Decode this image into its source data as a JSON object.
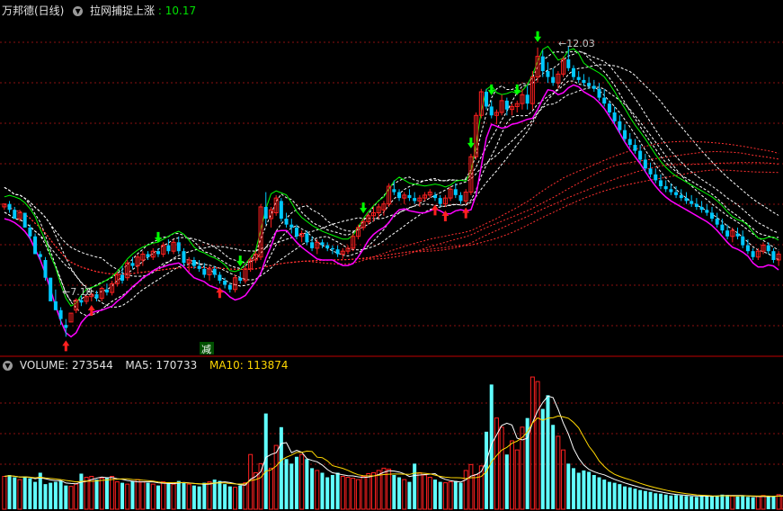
{
  "header": {
    "stock_name": "万邦德(日线)",
    "indicator_name": "拉网捕捉上涨",
    "indicator_value": "10.17"
  },
  "volume_header": {
    "label": "VOLUME:",
    "value": "273544",
    "ma5_label": "MA5:",
    "ma5_value": "170733",
    "ma10_label": "MA10:",
    "ma10_value": "113874"
  },
  "annotations": {
    "high": "12.03",
    "low": "7.10",
    "reduce": "减"
  },
  "colors": {
    "background": "#000000",
    "up": "#ff2020",
    "down": "#00c8ff",
    "doji": "#ffffff",
    "grid": "#8b1010",
    "divider": "#c00000",
    "ma_dashed": "#ffffff",
    "ma_slow": "#ff3030",
    "band_upper": "#00ff00",
    "band_lower_fast": "#ff00ff",
    "volume_up": "#ff2020",
    "volume_down": "#60ffff",
    "vol_ma5": "#ffffff",
    "vol_ma10": "#ffd700",
    "buy_arrow": "#ff2020",
    "sell_arrow": "#00ff00"
  },
  "chart_data": [
    {
      "type": "candlestick",
      "title": "万邦德(日线)",
      "ylim": [
        6.8,
        12.5
      ],
      "candles": [
        [
          9.3,
          9.35,
          9.25,
          9.35
        ],
        [
          9.35,
          9.4,
          9.2,
          9.25
        ],
        [
          9.25,
          9.3,
          9.1,
          9.1
        ],
        [
          9.1,
          9.25,
          9.05,
          9.2
        ],
        [
          9.2,
          9.2,
          8.95,
          8.95
        ],
        [
          8.95,
          9.0,
          8.75,
          8.8
        ],
        [
          8.8,
          8.85,
          8.5,
          8.5
        ],
        [
          8.5,
          8.55,
          8.4,
          8.45
        ],
        [
          8.4,
          8.45,
          8.05,
          8.1
        ],
        [
          8.1,
          8.1,
          7.7,
          7.7
        ],
        [
          7.7,
          7.9,
          7.55,
          7.55
        ],
        [
          7.55,
          7.6,
          7.3,
          7.4
        ],
        [
          7.3,
          7.4,
          7.1,
          7.25
        ],
        [
          7.35,
          7.5,
          7.35,
          7.5
        ],
        [
          7.55,
          7.75,
          7.5,
          7.72
        ],
        [
          7.72,
          7.8,
          7.62,
          7.68
        ],
        [
          7.7,
          7.8,
          7.65,
          7.78
        ],
        [
          7.78,
          7.85,
          7.7,
          7.82
        ],
        [
          7.82,
          7.88,
          7.7,
          7.75
        ],
        [
          7.75,
          7.95,
          7.7,
          7.92
        ],
        [
          7.9,
          8.0,
          7.8,
          7.85
        ],
        [
          7.85,
          8.05,
          7.8,
          8.0
        ],
        [
          8.0,
          8.2,
          7.95,
          8.15
        ],
        [
          8.15,
          8.3,
          8.0,
          8.05
        ],
        [
          8.1,
          8.4,
          8.05,
          8.35
        ],
        [
          8.35,
          8.45,
          8.25,
          8.3
        ],
        [
          8.3,
          8.5,
          8.2,
          8.45
        ],
        [
          8.4,
          8.55,
          8.3,
          8.5
        ],
        [
          8.5,
          8.55,
          8.4,
          8.45
        ],
        [
          8.45,
          8.6,
          8.4,
          8.55
        ],
        [
          8.55,
          8.6,
          8.45,
          8.5
        ],
        [
          8.5,
          8.7,
          8.45,
          8.65
        ],
        [
          8.65,
          8.75,
          8.5,
          8.55
        ],
        [
          8.55,
          8.75,
          8.5,
          8.7
        ],
        [
          8.7,
          8.8,
          8.5,
          8.55
        ],
        [
          8.55,
          8.6,
          8.3,
          8.35
        ],
        [
          8.35,
          8.45,
          8.2,
          8.4
        ],
        [
          8.4,
          8.45,
          8.25,
          8.3
        ],
        [
          8.3,
          8.4,
          8.2,
          8.25
        ],
        [
          8.25,
          8.35,
          8.1,
          8.15
        ],
        [
          8.15,
          8.3,
          8.05,
          8.25
        ],
        [
          8.25,
          8.3,
          8.1,
          8.15
        ],
        [
          8.15,
          8.2,
          8.0,
          8.05
        ],
        [
          8.05,
          8.1,
          7.92,
          7.98
        ],
        [
          7.98,
          8.0,
          7.85,
          7.9
        ],
        [
          7.9,
          8.15,
          7.85,
          8.1
        ],
        [
          8.1,
          8.2,
          8.0,
          8.05
        ],
        [
          8.05,
          8.3,
          8.0,
          8.25
        ],
        [
          8.25,
          8.45,
          8.2,
          8.4
        ],
        [
          8.4,
          8.55,
          8.35,
          8.5
        ],
        [
          8.45,
          9.35,
          8.4,
          9.3
        ],
        [
          9.3,
          9.55,
          9.0,
          9.1
        ],
        [
          9.1,
          9.3,
          8.95,
          9.25
        ],
        [
          9.2,
          9.5,
          9.15,
          9.45
        ],
        [
          9.4,
          9.45,
          9.05,
          9.1
        ],
        [
          9.1,
          9.2,
          8.95,
          9.0
        ],
        [
          9.0,
          9.1,
          8.85,
          8.95
        ],
        [
          8.95,
          9.0,
          8.75,
          8.8
        ],
        [
          8.8,
          8.9,
          8.7,
          8.85
        ],
        [
          8.85,
          8.9,
          8.65,
          8.7
        ],
        [
          8.7,
          8.8,
          8.55,
          8.6
        ],
        [
          8.6,
          8.75,
          8.5,
          8.7
        ],
        [
          8.7,
          8.75,
          8.6,
          8.65
        ],
        [
          8.65,
          8.7,
          8.55,
          8.6
        ],
        [
          8.6,
          8.65,
          8.5,
          8.58
        ],
        [
          8.58,
          8.65,
          8.45,
          8.5
        ],
        [
          8.5,
          8.6,
          8.42,
          8.55
        ],
        [
          8.55,
          8.65,
          8.5,
          8.6
        ],
        [
          8.6,
          8.85,
          8.55,
          8.8
        ],
        [
          8.8,
          9.0,
          8.75,
          8.95
        ],
        [
          8.95,
          9.1,
          8.9,
          9.05
        ],
        [
          9.05,
          9.2,
          9.0,
          9.15
        ],
        [
          9.15,
          9.3,
          9.05,
          9.2
        ],
        [
          9.2,
          9.35,
          9.1,
          9.3
        ],
        [
          9.25,
          9.4,
          9.15,
          9.35
        ],
        [
          9.35,
          9.7,
          9.3,
          9.65
        ],
        [
          9.6,
          9.75,
          9.5,
          9.55
        ],
        [
          9.55,
          9.6,
          9.4,
          9.45
        ],
        [
          9.45,
          9.55,
          9.35,
          9.5
        ],
        [
          9.5,
          9.6,
          9.4,
          9.45
        ],
        [
          9.45,
          9.55,
          9.35,
          9.4
        ],
        [
          9.4,
          9.5,
          9.3,
          9.45
        ],
        [
          9.45,
          9.55,
          9.4,
          9.5
        ],
        [
          9.5,
          9.6,
          9.45,
          9.55
        ],
        [
          9.5,
          9.55,
          9.4,
          9.45
        ],
        [
          9.45,
          9.5,
          9.3,
          9.35
        ],
        [
          9.35,
          9.5,
          9.3,
          9.45
        ],
        [
          9.45,
          9.65,
          9.4,
          9.6
        ],
        [
          9.6,
          9.7,
          9.45,
          9.5
        ],
        [
          9.5,
          9.55,
          9.35,
          9.4
        ],
        [
          9.4,
          9.6,
          9.35,
          9.55
        ],
        [
          9.55,
          10.2,
          9.5,
          10.15
        ],
        [
          10.15,
          10.9,
          10.1,
          10.85
        ],
        [
          10.85,
          11.3,
          10.8,
          11.25
        ],
        [
          11.25,
          11.3,
          10.95,
          11.0
        ],
        [
          11.0,
          11.1,
          10.8,
          10.85
        ],
        [
          10.85,
          10.95,
          10.7,
          10.9
        ],
        [
          10.9,
          11.2,
          10.85,
          11.1
        ],
        [
          11.1,
          11.15,
          10.85,
          10.95
        ],
        [
          10.95,
          11.05,
          10.85,
          11.0
        ],
        [
          11.0,
          11.1,
          10.9,
          11.05
        ],
        [
          11.05,
          11.3,
          10.95,
          11.2
        ],
        [
          11.2,
          11.35,
          10.95,
          11.05
        ],
        [
          11.05,
          11.6,
          10.95,
          11.5
        ],
        [
          11.5,
          12.0,
          11.4,
          11.85
        ],
        [
          11.85,
          11.95,
          11.5,
          11.6
        ],
        [
          11.6,
          11.75,
          11.4,
          11.5
        ],
        [
          11.5,
          11.65,
          11.35,
          11.4
        ],
        [
          11.4,
          11.6,
          11.3,
          11.55
        ],
        [
          11.55,
          11.85,
          11.5,
          11.8
        ],
        [
          11.8,
          12.03,
          11.6,
          11.65
        ],
        [
          11.65,
          11.7,
          11.45,
          11.5
        ],
        [
          11.5,
          11.6,
          11.4,
          11.45
        ],
        [
          11.45,
          11.55,
          11.35,
          11.4
        ],
        [
          11.4,
          11.5,
          11.3,
          11.35
        ],
        [
          11.35,
          11.45,
          11.25,
          11.3
        ],
        [
          11.3,
          11.4,
          11.1,
          11.15
        ],
        [
          11.15,
          11.3,
          11.0,
          11.05
        ],
        [
          11.05,
          11.1,
          10.85,
          10.9
        ],
        [
          10.9,
          11.0,
          10.7,
          10.75
        ],
        [
          10.75,
          10.85,
          10.55,
          10.6
        ],
        [
          10.6,
          10.7,
          10.4,
          10.45
        ],
        [
          10.45,
          10.55,
          10.3,
          10.35
        ],
        [
          10.35,
          10.45,
          10.2,
          10.25
        ],
        [
          10.25,
          10.35,
          10.05,
          10.1
        ],
        [
          10.1,
          10.2,
          9.9,
          9.95
        ],
        [
          9.95,
          10.05,
          9.8,
          9.85
        ],
        [
          9.85,
          9.95,
          9.7,
          9.75
        ],
        [
          9.75,
          9.85,
          9.6,
          9.65
        ],
        [
          9.65,
          9.75,
          9.55,
          9.6
        ],
        [
          9.6,
          9.7,
          9.5,
          9.55
        ],
        [
          9.55,
          9.65,
          9.45,
          9.5
        ],
        [
          9.5,
          9.6,
          9.4,
          9.45
        ],
        [
          9.45,
          9.55,
          9.35,
          9.4
        ],
        [
          9.4,
          9.5,
          9.3,
          9.35
        ],
        [
          9.35,
          9.45,
          9.25,
          9.3
        ],
        [
          9.3,
          9.4,
          9.2,
          9.25
        ],
        [
          9.25,
          9.35,
          9.15,
          9.2
        ],
        [
          9.2,
          9.3,
          9.05,
          9.1
        ],
        [
          9.1,
          9.2,
          8.95,
          9.0
        ],
        [
          9.0,
          9.1,
          8.85,
          8.9
        ],
        [
          8.9,
          9.0,
          8.75,
          8.8
        ],
        [
          8.8,
          8.95,
          8.7,
          8.9
        ],
        [
          8.85,
          8.95,
          8.75,
          8.8
        ],
        [
          8.8,
          8.9,
          8.6,
          8.65
        ],
        [
          8.65,
          8.75,
          8.5,
          8.55
        ],
        [
          8.55,
          8.6,
          8.4,
          8.45
        ],
        [
          8.45,
          8.6,
          8.4,
          8.55
        ],
        [
          8.55,
          8.7,
          8.5,
          8.65
        ],
        [
          8.65,
          8.7,
          8.5,
          8.55
        ],
        [
          8.55,
          8.6,
          8.35,
          8.4
        ],
        [
          8.4,
          8.55,
          8.3,
          8.5
        ]
      ]
    },
    {
      "type": "bar",
      "title": "VOLUME",
      "ylim": [
        0,
        300000
      ],
      "values": [
        72000,
        75000,
        70000,
        65000,
        72000,
        68000,
        60000,
        80000,
        55000,
        58000,
        60000,
        62000,
        52000,
        50000,
        55000,
        78000,
        70000,
        72000,
        65000,
        68000,
        70000,
        72000,
        60000,
        58000,
        55000,
        62000,
        65000,
        60000,
        58000,
        55000,
        52000,
        60000,
        58000,
        55000,
        62000,
        58000,
        55000,
        52000,
        50000,
        58000,
        60000,
        65000,
        62000,
        55000,
        50000,
        48000,
        52000,
        58000,
        120000,
        80000,
        100000,
        210000,
        90000,
        140000,
        180000,
        110000,
        100000,
        115000,
        120000,
        110000,
        90000,
        85000,
        80000,
        70000,
        75000,
        80000,
        72000,
        70000,
        68000,
        65000,
        72000,
        78000,
        80000,
        85000,
        90000,
        88000,
        75000,
        70000,
        65000,
        60000,
        100000,
        80000,
        75000,
        70000,
        65000,
        60000,
        58000,
        60000,
        62000,
        58000,
        85000,
        98000,
        76000,
        95000,
        170000,
        273544,
        200000,
        180000,
        120000,
        150000,
        130000,
        180000,
        200000,
        290000,
        280000,
        220000,
        250000,
        185000,
        160000,
        130000,
        100000,
        90000,
        80000,
        85000,
        82000,
        75000,
        70000,
        65000,
        60000,
        58000,
        55000,
        50000,
        48000,
        45000,
        42000,
        40000,
        38000,
        35000,
        34000,
        32000,
        30000,
        31000,
        30000,
        29000,
        28000,
        27000,
        30000,
        29000,
        28000,
        30000,
        32000,
        31000,
        29000,
        28000,
        30000,
        27000,
        26000,
        28000,
        30000,
        27000,
        29000,
        32000,
        30000,
        28000
      ]
    }
  ]
}
